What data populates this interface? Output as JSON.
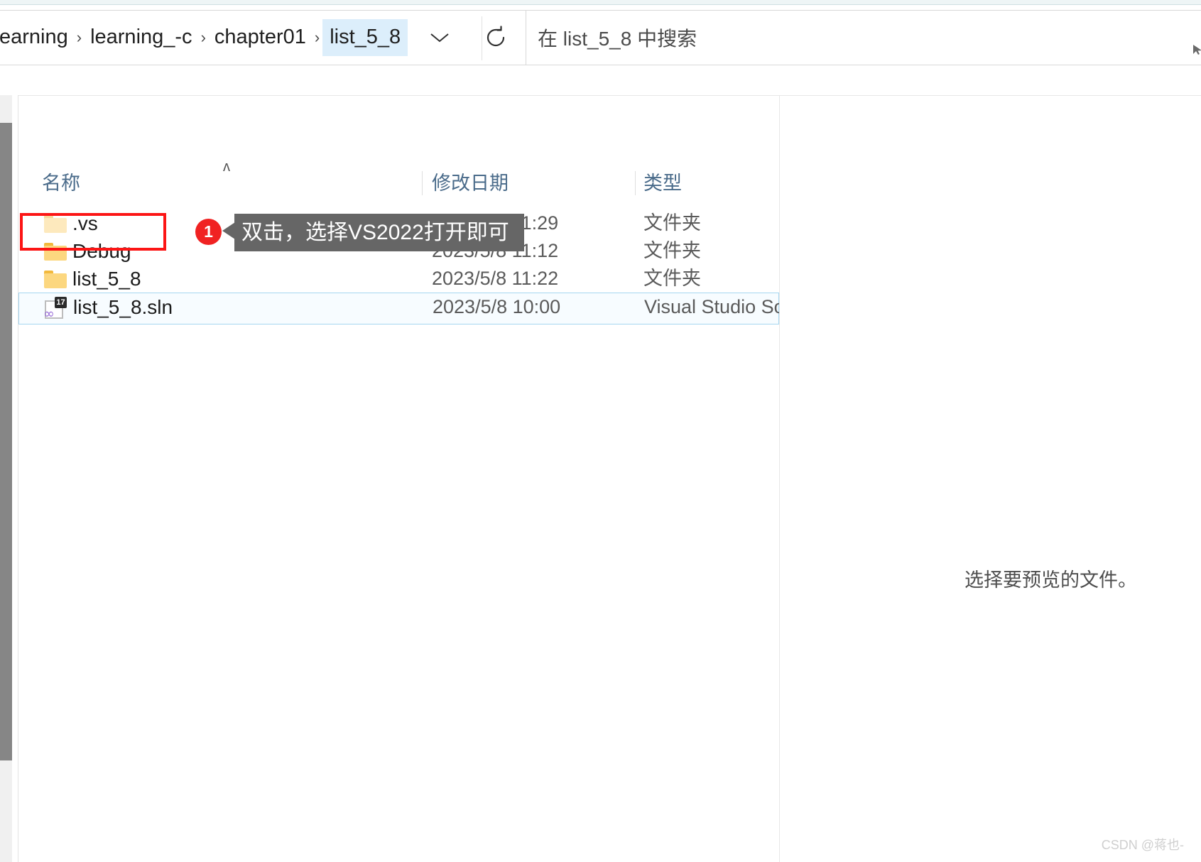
{
  "window": {
    "type": "file-explorer"
  },
  "address_bar": {
    "breadcrumbs": [
      {
        "label": "earning",
        "active": false
      },
      {
        "label": "learning_-c",
        "active": false
      },
      {
        "label": "chapter01",
        "active": false
      },
      {
        "label": "list_5_8",
        "active": true
      }
    ],
    "separator": "›",
    "dropdown_icon": "chevron-down-icon",
    "refresh_icon": "refresh-icon"
  },
  "search": {
    "placeholder": "在 list_5_8 中搜索",
    "value": ""
  },
  "file_list": {
    "columns": [
      {
        "key": "name",
        "label": "名称"
      },
      {
        "key": "date",
        "label": "修改日期"
      },
      {
        "key": "type",
        "label": "类型"
      }
    ],
    "sort_caret": "ʌ",
    "rows": [
      {
        "name": ".vs",
        "date": "2023/5/8 11:29",
        "type": "文件夹",
        "icon": "folder-icon-hidden",
        "selected": false
      },
      {
        "name": "Debug",
        "date": "2023/5/8 11:12",
        "type": "文件夹",
        "icon": "folder-icon",
        "selected": false
      },
      {
        "name": "list_5_8",
        "date": "2023/5/8 11:22",
        "type": "文件夹",
        "icon": "folder-icon",
        "selected": false
      },
      {
        "name": "list_5_8.sln",
        "date": "2023/5/8 10:00",
        "type": "Visual Studio Solu",
        "icon": "visual-studio-solution-icon",
        "icon_badge": "17",
        "selected": true
      }
    ]
  },
  "annotations": {
    "marker_number": "1",
    "callout_text": "双击，选择VS2022打开即可",
    "highlight_color": "#fc1515",
    "marker_color": "#f02222",
    "callout_bg": "#666666"
  },
  "preview_pane": {
    "message": "选择要预览的文件。"
  },
  "watermark": {
    "text": "CSDN @蒋也-"
  }
}
